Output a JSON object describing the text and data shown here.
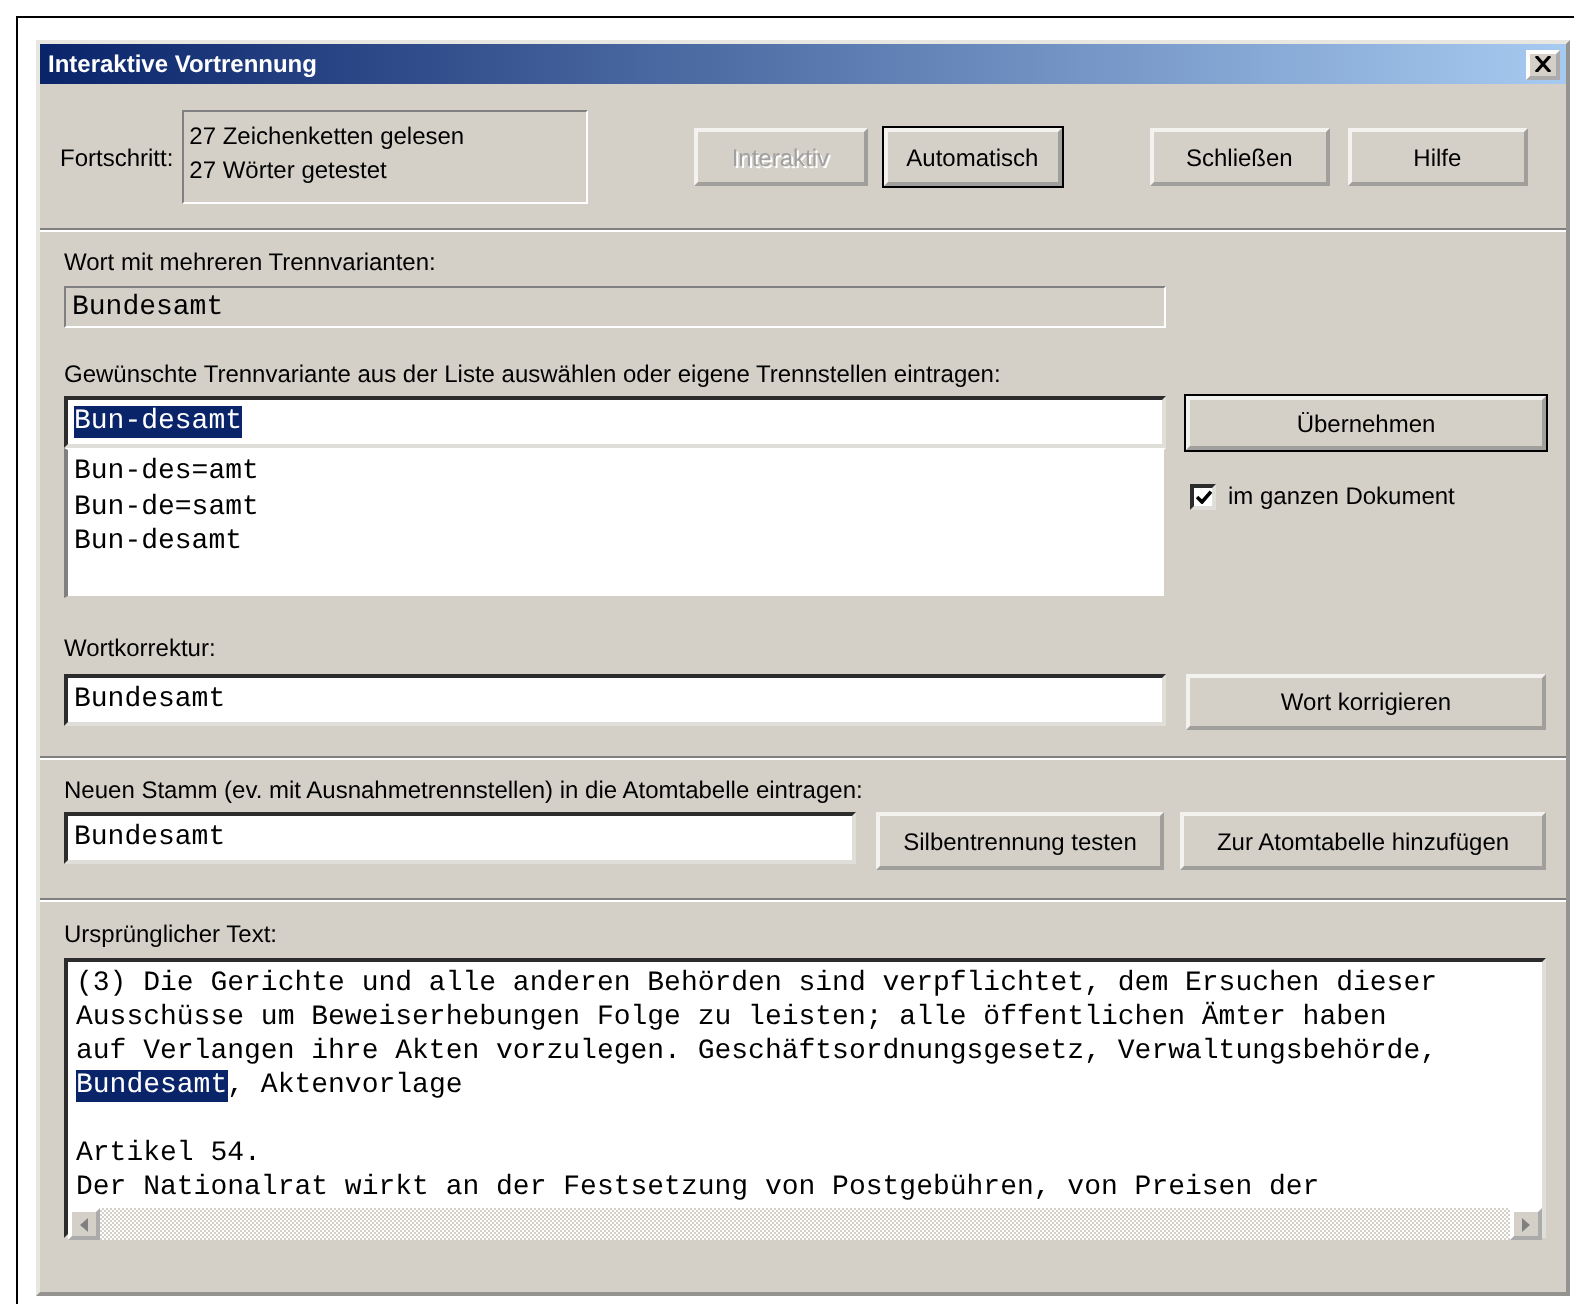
{
  "window": {
    "title": "Interaktive Vortrennung"
  },
  "progress": {
    "label": "Fortschritt:",
    "lines": [
      "27 Zeichenketten gelesen",
      "27 Wörter getestet"
    ]
  },
  "top_buttons": [
    {
      "label": "Interaktiv",
      "disabled": true,
      "default": false
    },
    {
      "label": "Automatisch",
      "disabled": false,
      "default": true
    },
    {
      "label": "Schließen",
      "disabled": false,
      "default": false
    },
    {
      "label": "Hilfe",
      "disabled": false,
      "default": false
    }
  ],
  "variants_word": {
    "label": "Wort mit mehreren Trennvarianten:",
    "value": "Bundesamt"
  },
  "choice": {
    "label": "Gewünschte Trennvariante aus der Liste auswählen oder eigene Trennstellen eintragen:",
    "value": "Bun-desamt",
    "value_selected": true,
    "items": [
      "Bun-des=amt",
      "Bun-de=samt",
      "Bun-desamt"
    ],
    "button": {
      "label": "Übernehmen",
      "disabled": false,
      "default": true
    },
    "checkbox": {
      "label": "im ganzen Dokument",
      "checked": true
    }
  },
  "correction": {
    "label": "Wortkorrektur:",
    "value": "Bundesamt",
    "button": {
      "label": "Wort korrigieren",
      "disabled": false,
      "default": false
    }
  },
  "atom": {
    "label": "Neuen Stamm (ev. mit Ausnahmetrennstellen) in die Atomtabelle eintragen:",
    "value": "Bundesamt",
    "buttons": [
      {
        "label": "Silbentrennung testen",
        "disabled": false,
        "default": false
      },
      {
        "label": "Zur Atomtabelle hinzufügen",
        "disabled": false,
        "default": false
      }
    ]
  },
  "original_text": {
    "label": "Ursprünglicher Text:",
    "paragraphs": [
      [
        {
          "segments": [
            {
              "text": "(3) Die Gerichte und alle anderen Behörden sind verpflichtet, dem Ersuchen dieser",
              "selected": false
            }
          ]
        },
        {
          "segments": [
            {
              "text": "Ausschüsse um Beweiserhebungen Folge zu leisten; alle öffentlichen Ämter haben",
              "selected": false
            }
          ]
        },
        {
          "segments": [
            {
              "text": "auf Verlangen ihre Akten vorzulegen. Geschäftsordnungsgesetz, Verwaltungsbehörde,",
              "selected": false
            }
          ]
        },
        {
          "segments": [
            {
              "text": "Bundesamt",
              "selected": true
            },
            {
              "text": ", Aktenvorlage",
              "selected": false
            }
          ]
        }
      ],
      [
        {
          "segments": [
            {
              "text": "Artikel 54.",
              "selected": false
            }
          ]
        },
        {
          "segments": [
            {
              "text": "Der Nationalrat wirkt an der Festsetzung von Postgebühren, von Preisen der",
              "selected": false
            }
          ]
        }
      ]
    ]
  }
}
